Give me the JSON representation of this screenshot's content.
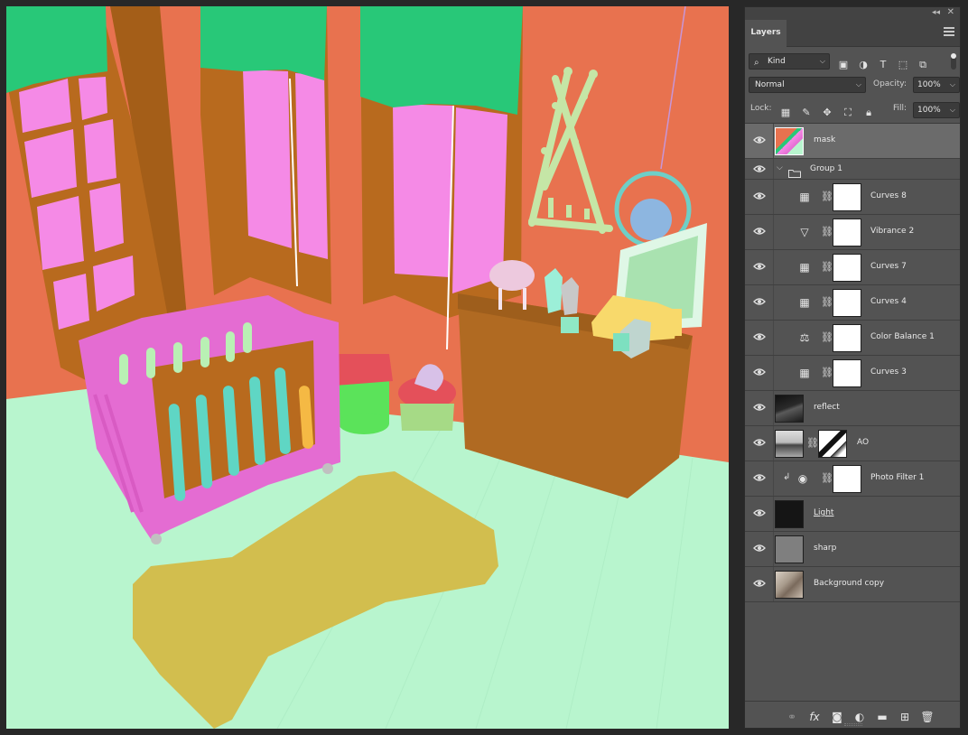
{
  "panel": {
    "tab_label": "Layers",
    "kind_filter": "Kind",
    "blend_mode": "Normal",
    "opacity_label": "Opacity:",
    "opacity_value": "100%",
    "lock_label": "Lock:",
    "fill_label": "Fill:",
    "fill_value": "100%"
  },
  "filter_icons": [
    "image-filter-icon",
    "adjustment-filter-icon",
    "type-filter-icon",
    "shape-filter-icon",
    "smart-object-filter-icon"
  ],
  "lock_icons": [
    "lock-transparent-icon",
    "lock-paint-icon",
    "lock-position-icon",
    "lock-artboard-icon",
    "lock-all-icon"
  ],
  "layers": [
    {
      "name": "mask",
      "kind": "pixel",
      "selected": true
    },
    {
      "name": "Group 1",
      "kind": "group"
    },
    {
      "name": "Curves 8",
      "kind": "adjustment",
      "icon": "curves-icon"
    },
    {
      "name": "Vibrance 2",
      "kind": "adjustment",
      "icon": "vibrance-icon"
    },
    {
      "name": "Curves 7",
      "kind": "adjustment",
      "icon": "curves-icon"
    },
    {
      "name": "Curves 4",
      "kind": "adjustment",
      "icon": "curves-icon"
    },
    {
      "name": "Color Balance 1",
      "kind": "adjustment",
      "icon": "color-balance-icon"
    },
    {
      "name": "Curves 3",
      "kind": "adjustment",
      "icon": "curves-icon"
    },
    {
      "name": "reflect",
      "kind": "pixel"
    },
    {
      "name": "AO",
      "kind": "pixel-mask"
    },
    {
      "name": "Photo Filter 1",
      "kind": "adjustment-clipped",
      "icon": "photo-filter-icon"
    },
    {
      "name": "Light",
      "kind": "pixel"
    },
    {
      "name": "sharp",
      "kind": "pixel"
    },
    {
      "name": "Background copy",
      "kind": "pixel"
    }
  ],
  "bottom_icons": [
    "link-layers-icon",
    "fx-icon",
    "add-mask-icon",
    "new-adjustment-icon",
    "new-group-icon",
    "new-layer-icon",
    "delete-layer-icon"
  ],
  "colors": {
    "wall": "#E8724F",
    "window_frame": "#B86A1E",
    "glass": "#F58AE6",
    "curtain": "#28C878",
    "floor": "#B8F5CE",
    "rug": "#D2BE4E",
    "crib": "#E46CD2",
    "dresser": "#B06A22",
    "panel_bg": "#535353"
  }
}
